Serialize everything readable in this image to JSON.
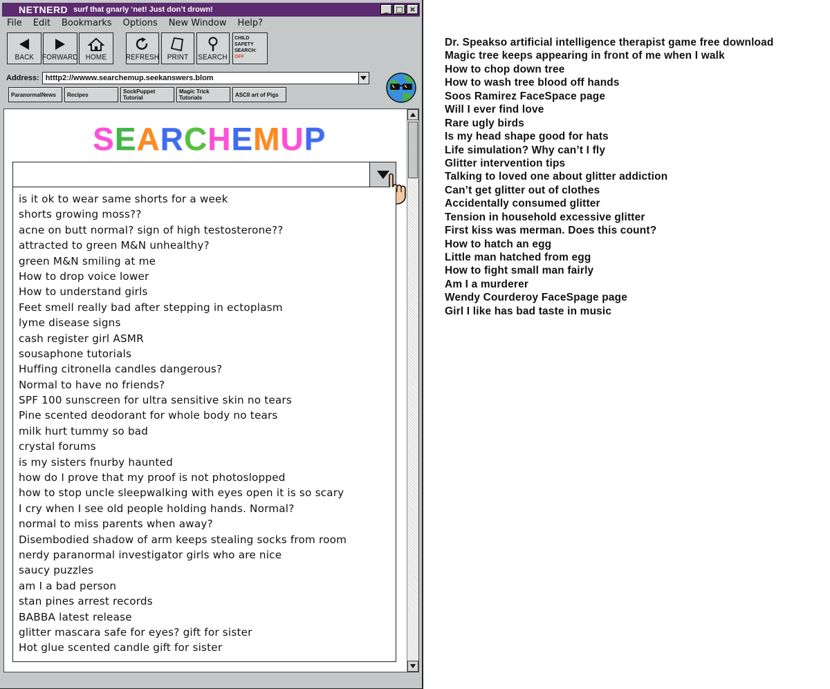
{
  "window": {
    "app_name": "NETNERD",
    "tagline": "surf that gnarly ‘net! Just don’t drown!",
    "controls": [
      "_",
      "□",
      "×"
    ]
  },
  "menu": [
    "File",
    "Edit",
    "Bookmarks",
    "Options",
    "New Window",
    "Help?"
  ],
  "toolbar": {
    "back": "BACK",
    "forward": "FORWARD",
    "home": "HOME",
    "refresh": "REFRESH",
    "print": "PRINT",
    "search": "SEARCH",
    "child_safety": [
      "CHILD",
      "SAFETY",
      "SEARCH:"
    ],
    "child_safety_status": "OFF"
  },
  "address": {
    "label": "Address:",
    "url": "htttp2://wwww.searchemup.seekanswers.blom"
  },
  "bookmarks": [
    "ParanormalNews",
    "Recipes",
    "SockPuppet\nTutorial",
    "Magic Trick\nTutorials",
    "ASCII art of Pigs"
  ],
  "logo": {
    "letters": [
      "S",
      "E",
      "A",
      "R",
      "C",
      "H",
      "E",
      "M",
      "U",
      "P"
    ],
    "colors": [
      "#ff4fd8",
      "#43b649",
      "#ff8a1f",
      "#3f6cf0",
      "#55c040",
      "#ff4fd8",
      "#3f6cf0",
      "#ff8a1f",
      "#ff4fd8",
      "#3f6cf0"
    ]
  },
  "search": {
    "value": "",
    "suggestions": [
      "is it ok to wear same shorts for a week",
      "shorts growing moss??",
      "acne on butt normal? sign of high testosterone??",
      "attracted to green M&N unhealthy?",
      "green M&N smiling at me",
      "How to drop voice lower",
      "How to understand girls",
      "Feet smell really bad after stepping in ectoplasm",
      "lyme disease signs",
      "cash register girl ASMR",
      "sousaphone tutorials",
      "Huffing citronella candles dangerous?",
      "Normal to have no friends?",
      "SPF 100 sunscreen for ultra sensitive skin no tears",
      "Pine scented deodorant for whole body no tears",
      "milk hurt tummy so bad",
      "crystal forums",
      "is my sisters fnurby haunted",
      "how do I prove that my proof is not photoslopped",
      "how to stop uncle sleepwalking with eyes open it is so scary",
      "I cry when I see old people holding hands. Normal?",
      "normal to miss parents when away?",
      "Disembodied shadow of arm keeps stealing socks from room",
      "nerdy paranormal investigator girls who are nice",
      "saucy puzzles",
      "am I a bad person",
      "stan pines arrest records",
      "BABBA latest release",
      "glitter mascara safe for eyes? gift for sister",
      "Hot glue scented candle gift for sister"
    ]
  },
  "side_list": [
    "Dr. Speakso artificial intelligence therapist game free download",
    "Magic tree keeps appearing in front of me when I walk",
    "How to chop down tree",
    "How to wash tree blood off hands",
    "Soos Ramirez FaceSpace page",
    "Will I ever find love",
    "Rare ugly birds",
    "Is my head shape good for hats",
    "Life simulation? Why can’t I fly",
    "Glitter intervention tips",
    "Talking to loved one about glitter addiction",
    "Can’t get glitter out of clothes",
    "Accidentally consumed glitter",
    "Tension in household excessive glitter",
    "First kiss was merman. Does this count?",
    "How to hatch an egg",
    "Little man hatched from egg",
    "How to fight small man fairly",
    "Am I a murderer",
    "Wendy Courderoy FaceSpage page",
    "Girl I like has bad taste in music"
  ],
  "colors": {
    "titlebar": "#5c2a6e",
    "chrome": "#c4c8c8",
    "status_off": "#d24a3a"
  },
  "icons": [
    "back-arrow-icon",
    "forward-arrow-icon",
    "home-icon",
    "refresh-icon",
    "print-icon",
    "search-magnifier-icon",
    "globe-sunglasses-icon",
    "pointing-hand-cursor-icon",
    "dropdown-arrow-icon"
  ]
}
